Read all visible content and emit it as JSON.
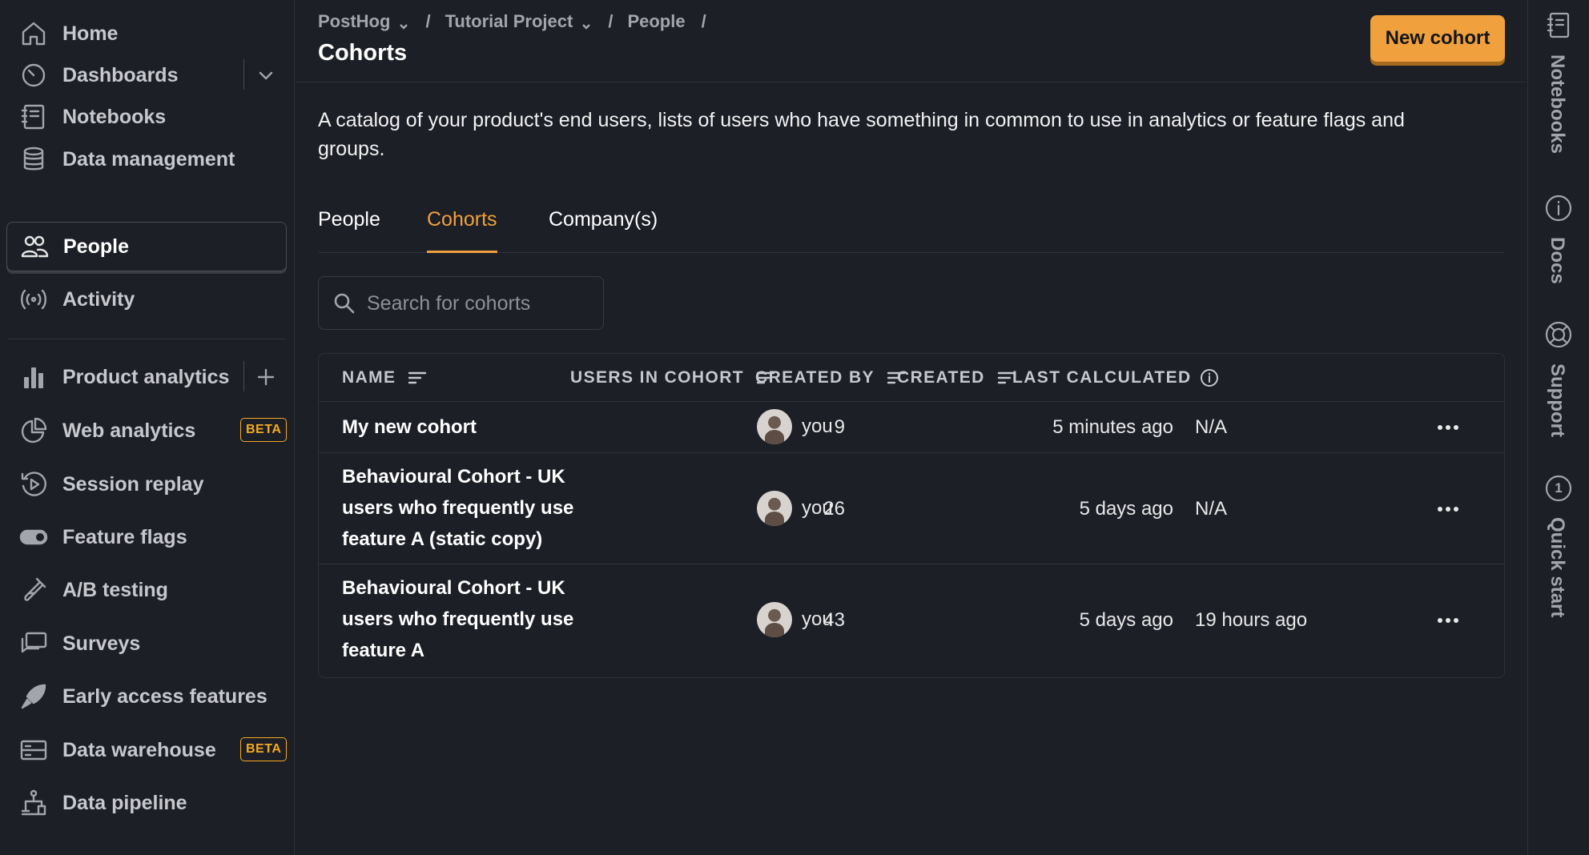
{
  "sidebar": {
    "items": [
      {
        "label": "Home",
        "icon": "home-icon"
      },
      {
        "label": "Dashboards",
        "icon": "dashboard-icon"
      },
      {
        "label": "Notebooks",
        "icon": "notebook-icon"
      },
      {
        "label": "Data management",
        "icon": "database-icon"
      },
      {
        "label": "People",
        "icon": "people-icon"
      },
      {
        "label": "Activity",
        "icon": "broadcast-icon"
      },
      {
        "label": "Product analytics",
        "icon": "bar-chart-icon"
      },
      {
        "label": "Web analytics",
        "icon": "pie-chart-icon",
        "badge": "BETA"
      },
      {
        "label": "Session replay",
        "icon": "replay-icon"
      },
      {
        "label": "Feature flags",
        "icon": "toggle-icon"
      },
      {
        "label": "A/B testing",
        "icon": "flask-icon"
      },
      {
        "label": "Surveys",
        "icon": "chat-icon"
      },
      {
        "label": "Early access features",
        "icon": "rocket-icon"
      },
      {
        "label": "Data warehouse",
        "icon": "server-icon",
        "badge": "BETA"
      },
      {
        "label": "Data pipeline",
        "icon": "pipeline-icon"
      }
    ]
  },
  "header": {
    "breadcrumb": [
      "PostHog",
      "Tutorial Project",
      "People"
    ],
    "separator": "/",
    "title": "Cohorts",
    "new_cohort_label": "New cohort"
  },
  "main": {
    "description": "A catalog of your product's end users, lists of users who have something in common to use in analytics or feature flags and groups.",
    "tabs": [
      {
        "label": "People",
        "active": false
      },
      {
        "label": "Cohorts",
        "active": true
      },
      {
        "label": "Company(s)",
        "active": false
      }
    ],
    "search": {
      "placeholder": "Search for cohorts",
      "value": ""
    },
    "table": {
      "columns": [
        "NAME",
        "USERS IN COHORT",
        "CREATED BY",
        "CREATED",
        "LAST CALCULATED"
      ],
      "rows": [
        {
          "name": "My new cohort",
          "users": "9",
          "created_by": "you",
          "created": "5 minutes ago",
          "last_calculated": "N/A"
        },
        {
          "name": "Behavioural Cohort - UK users who frequently use feature A (static copy)",
          "users": "26",
          "created_by": "you",
          "created": "5 days ago",
          "last_calculated": "N/A"
        },
        {
          "name": "Behavioural Cohort - UK users who frequently use feature A",
          "users": "43",
          "created_by": "you",
          "created": "5 days ago",
          "last_calculated": "19 hours ago"
        }
      ]
    }
  },
  "rightbar": {
    "items": [
      {
        "label": "Notebooks",
        "icon": "notebook-icon"
      },
      {
        "label": "Docs",
        "icon": "info-icon"
      },
      {
        "label": "Support",
        "icon": "lifebuoy-icon"
      },
      {
        "label": "Quick start",
        "icon": "progress-icon",
        "count": "1"
      }
    ]
  },
  "colors": {
    "background": "#1d1f27",
    "accent": "#f0a13e",
    "beta": "#f4a91f",
    "border": "#2e3039"
  }
}
